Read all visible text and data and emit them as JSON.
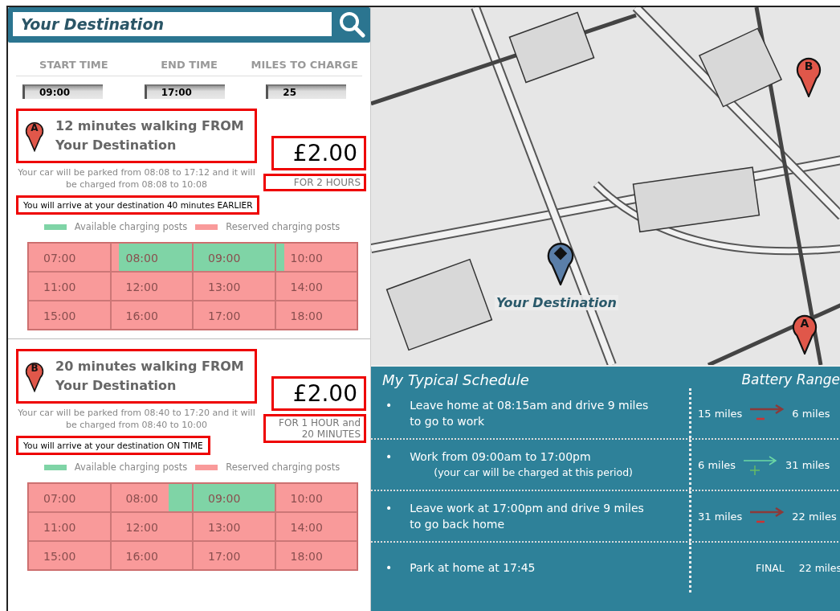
{
  "search": {
    "value": "Your Destination"
  },
  "fields": [
    {
      "label": "START TIME",
      "value": "09:00"
    },
    {
      "label": "END TIME",
      "value": "17:00"
    },
    {
      "label": "MILES TO CHARGE",
      "value": "25"
    }
  ],
  "options": [
    {
      "marker": "A",
      "title": "12 minutes walking FROM Your Destination",
      "description": "Your car will be parked from 08:08 to 17:12 and it will be charged from 08:08 to 10:08",
      "arrival": "You will arrive at your destination 40 minutes EARLIER",
      "price": "£2.00",
      "duration": "FOR 2 HOURS",
      "legend": [
        "Available charging posts",
        "Reserved charging posts"
      ],
      "slots": [
        {
          "time": "07:00",
          "kind": "reserved"
        },
        {
          "time": "08:00",
          "kind": "available_end",
          "level": 0.91
        },
        {
          "time": "09:00",
          "kind": "available"
        },
        {
          "time": "10:00",
          "kind": "available_start",
          "level": 0.1
        },
        {
          "time": "11:00",
          "kind": "reserved"
        },
        {
          "time": "12:00",
          "kind": "reserved"
        },
        {
          "time": "13:00",
          "kind": "reserved"
        },
        {
          "time": "14:00",
          "kind": "reserved"
        },
        {
          "time": "15:00",
          "kind": "reserved"
        },
        {
          "time": "16:00",
          "kind": "reserved"
        },
        {
          "time": "17:00",
          "kind": "reserved"
        },
        {
          "time": "18:00",
          "kind": "reserved"
        }
      ]
    },
    {
      "marker": "B",
      "title": "20 minutes walking FROM Your Destination",
      "description": "Your car will be parked from 08:40 to 17:20 and it will be charged from 08:40 to 10:00",
      "arrival": "You will arrive at your destination ON TIME",
      "price": "£2.00",
      "duration": "FOR 1 HOUR and 20 MINUTES",
      "legend": [
        "Available charging posts",
        "Reserved charging posts"
      ],
      "slots": [
        {
          "time": "07:00",
          "kind": "reserved"
        },
        {
          "time": "08:00",
          "kind": "available_end",
          "level": 0.29
        },
        {
          "time": "09:00",
          "kind": "available"
        },
        {
          "time": "10:00",
          "kind": "reserved"
        },
        {
          "time": "11:00",
          "kind": "reserved"
        },
        {
          "time": "12:00",
          "kind": "reserved"
        },
        {
          "time": "13:00",
          "kind": "reserved"
        },
        {
          "time": "14:00",
          "kind": "reserved"
        },
        {
          "time": "15:00",
          "kind": "reserved"
        },
        {
          "time": "16:00",
          "kind": "reserved"
        },
        {
          "time": "17:00",
          "kind": "reserved"
        },
        {
          "time": "18:00",
          "kind": "reserved"
        }
      ]
    }
  ],
  "map": {
    "kind": "picture",
    "destination_label": "Your Destination",
    "markers": [
      {
        "letter": "B",
        "kind": "option"
      },
      {
        "letter": "A",
        "kind": "option"
      }
    ]
  },
  "schedule": {
    "title": "My Typical Schedule",
    "range_title": "Battery Range",
    "rows": [
      {
        "bullet": "•",
        "text": "Leave home  at 08:15am and drive 9 miles to go to work",
        "range": {
          "kind": "decrease",
          "from": "15 miles",
          "to": "6 miles"
        }
      },
      {
        "bullet": "•",
        "text": "Work from  09:00am to 17:00pm",
        "note": "(your car will be charged at this  period)",
        "range": {
          "kind": "increase",
          "from": "6 miles",
          "to": "31 miles"
        }
      },
      {
        "bullet": "•",
        "text": "Leave work at 17:00pm and drive 9 miles to go back home",
        "range": {
          "kind": "decrease",
          "from": "31 miles",
          "to": "22 miles"
        }
      },
      {
        "bullet": "•",
        "text": "Park at home  at 17:45",
        "range": {
          "kind": "final",
          "from": "FINAL",
          "to": "22 miles"
        }
      }
    ]
  }
}
